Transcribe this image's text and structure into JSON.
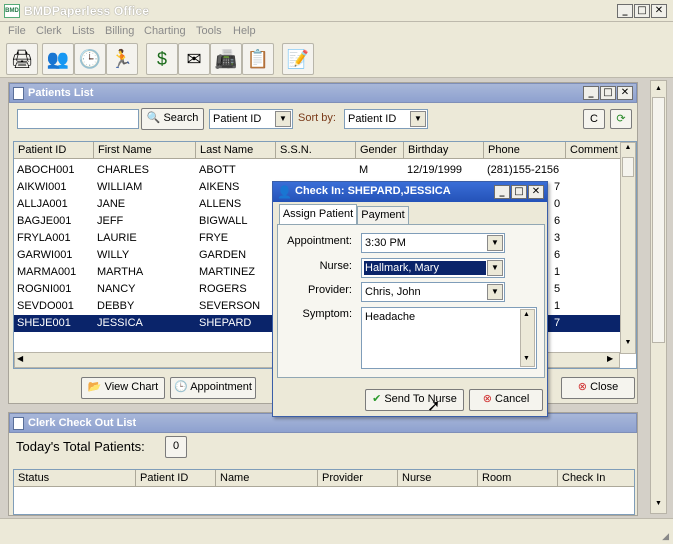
{
  "app": {
    "title": "BMDPaperless Office",
    "icon_text": "BMD"
  },
  "menu": [
    "File",
    "Clerk",
    "Lists",
    "Billing",
    "Charting",
    "Tools",
    "Help"
  ],
  "toolbar_icons": [
    "scanner-icon",
    "patients-icon",
    "clock-icon",
    "runner-icon",
    "billing-icon",
    "mail-icon",
    "fax-icon",
    "notes-icon",
    "edit-icon"
  ],
  "patients": {
    "title": "Patients List",
    "search_label": "Search",
    "search_value": "",
    "search_by": "Patient ID",
    "sort_label": "Sort by:",
    "sort_by": "Patient ID",
    "clear_label": "C",
    "columns": [
      "Patient ID",
      "First Name",
      "Last Name",
      "S.S.N.",
      "Gender",
      "Birthday",
      "Phone",
      "Comment"
    ],
    "rows": [
      {
        "id": "ABOCH001",
        "first": "CHARLES",
        "last": "ABOTT",
        "gender": "M",
        "birthday": "12/19/1999",
        "phone": "(281)155-2156"
      },
      {
        "id": "AIKWI001",
        "first": "WILLIAM",
        "last": "AIKENS",
        "phone_tail": "7"
      },
      {
        "id": "ALLJA001",
        "first": "JANE",
        "last": "ALLENS",
        "phone_tail": "0"
      },
      {
        "id": "BAGJE001",
        "first": "JEFF",
        "last": "BIGWALL",
        "phone_tail": "6"
      },
      {
        "id": "FRYLA001",
        "first": "LAURIE",
        "last": "FRYE",
        "phone_tail": "3"
      },
      {
        "id": "GARWI001",
        "first": "WILLY",
        "last": "GARDEN",
        "phone_tail": "6"
      },
      {
        "id": "MARMA001",
        "first": "MARTHA",
        "last": "MARTINEZ",
        "phone_tail": "1"
      },
      {
        "id": "ROGNI001",
        "first": "NANCY",
        "last": "ROGERS",
        "phone_tail": "5"
      },
      {
        "id": "SEVDO001",
        "first": "DEBBY",
        "last": "SEVERSON",
        "phone_tail": "1"
      },
      {
        "id": "SHEJE001",
        "first": "JESSICA",
        "last": "SHEPARD",
        "phone_tail": "7"
      }
    ],
    "view_chart": "View Chart",
    "appointment": "Appointment",
    "close": "Close"
  },
  "checkout": {
    "title": "Clerk Check Out List",
    "total_label": "Today's Total Patients:",
    "total_value": "0",
    "columns": [
      "Status",
      "Patient ID",
      "Name",
      "Provider",
      "Nurse",
      "Room",
      "Check In"
    ]
  },
  "dialog": {
    "title": "Check In: SHEPARD,JESSICA",
    "tab_assign": "Assign Patient",
    "tab_payment": "Payment",
    "appointment_label": "Appointment:",
    "appointment_value": "3:30 PM",
    "nurse_label": "Nurse:",
    "nurse_value": "Hallmark, Mary",
    "provider_label": "Provider:",
    "provider_value": "Chris, John",
    "symptom_label": "Symptom:",
    "symptom_value": "Headache",
    "send_label": "Send To Nurse",
    "cancel_label": "Cancel"
  }
}
